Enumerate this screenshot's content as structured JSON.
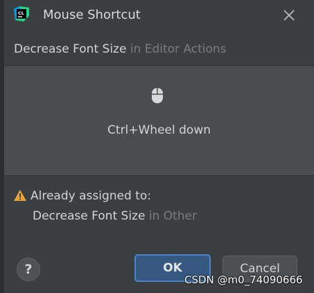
{
  "colors": {
    "dialog_bg": "#3c3f41",
    "panel_bg": "#4a4d4f",
    "ok_bg": "#365880",
    "ok_border": "#4a86c7",
    "warning": "#e8a33d",
    "muted_text": "#7a7d80"
  },
  "titlebar": {
    "app_icon": "clion-app-icon",
    "app_icon_text": "CL",
    "title": "Mouse Shortcut",
    "close_icon": "close-icon"
  },
  "action": {
    "name": "Decrease Font Size",
    "context": "in Editor Actions"
  },
  "shortcut_panel": {
    "icon": "mouse-icon",
    "shortcut": "Ctrl+Wheel down"
  },
  "conflict": {
    "icon": "warning-icon",
    "label": "Already assigned to:",
    "action_name": "Decrease Font Size",
    "context": "in Other"
  },
  "buttons": {
    "help_label": "?",
    "ok_label": "OK",
    "cancel_label": "Cancel"
  },
  "watermark": "CSDN @m0_74090666"
}
